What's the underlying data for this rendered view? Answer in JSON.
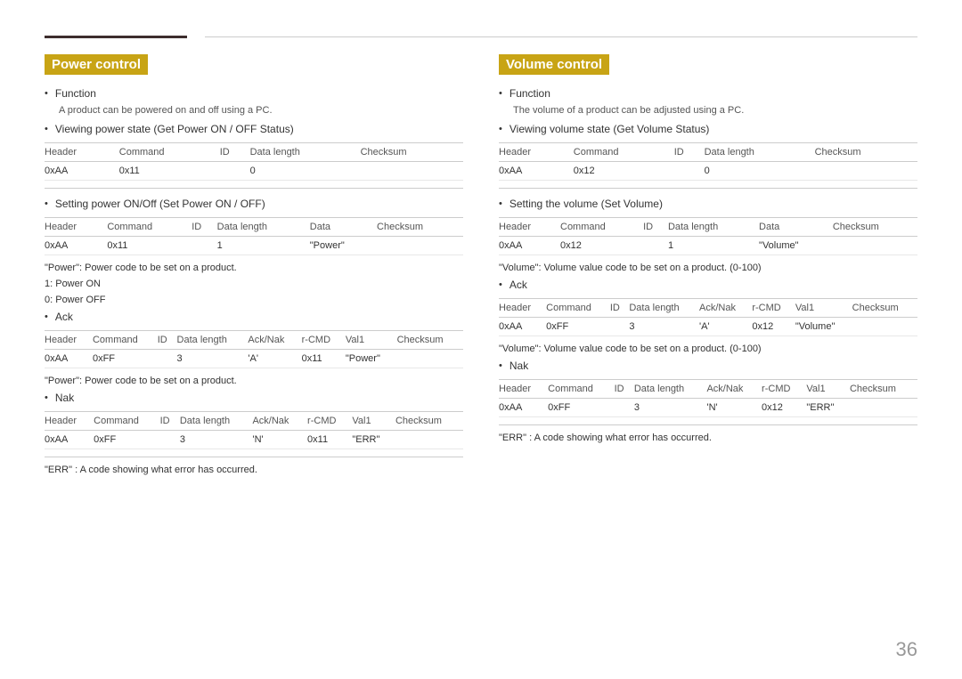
{
  "page_number": "36",
  "top_bar": {
    "bar_present": true
  },
  "left": {
    "title": "Power control",
    "function_label": "Function",
    "function_text": "A product can be powered on and off using a PC.",
    "viewing_label": "Viewing power state (Get Power ON / OFF Status)",
    "table1": {
      "headers": [
        "Header",
        "Command",
        "ID",
        "Data length",
        "Checksum"
      ],
      "rows": [
        [
          "0xAA",
          "0x11",
          "",
          "0",
          ""
        ]
      ]
    },
    "setting_label": "Setting power ON/Off (Set Power ON / OFF)",
    "table2": {
      "headers": [
        "Header",
        "Command",
        "ID",
        "Data length",
        "Data",
        "Checksum"
      ],
      "rows": [
        [
          "0xAA",
          "0x11",
          "",
          "1",
          "\"Power\"",
          ""
        ]
      ]
    },
    "note1": "\"Power\": Power code to be set on a product.",
    "power_on": "1: Power ON",
    "power_off": "0: Power OFF",
    "ack_label": "Ack",
    "table3": {
      "headers": [
        "Header",
        "Command",
        "ID",
        "Data length",
        "Ack/Nak",
        "r-CMD",
        "Val1",
        "Checksum"
      ],
      "rows": [
        [
          "0xAA",
          "0xFF",
          "",
          "3",
          "'A'",
          "0x11",
          "\"Power\"",
          ""
        ]
      ]
    },
    "note2": "\"Power\": Power code to be set on a product.",
    "nak_label": "Nak",
    "table4": {
      "headers": [
        "Header",
        "Command",
        "ID",
        "Data length",
        "Ack/Nak",
        "r-CMD",
        "Val1",
        "Checksum"
      ],
      "rows": [
        [
          "0xAA",
          "0xFF",
          "",
          "3",
          "'N'",
          "0x11",
          "\"ERR\"",
          ""
        ]
      ]
    },
    "err_note": "\"ERR\" : A code showing what error has occurred."
  },
  "right": {
    "title": "Volume control",
    "function_label": "Function",
    "function_text": "The volume of a product can be adjusted using a PC.",
    "viewing_label": "Viewing volume state (Get Volume Status)",
    "table1": {
      "headers": [
        "Header",
        "Command",
        "ID",
        "Data length",
        "Checksum"
      ],
      "rows": [
        [
          "0xAA",
          "0x12",
          "",
          "0",
          ""
        ]
      ]
    },
    "setting_label": "Setting the volume (Set Volume)",
    "table2": {
      "headers": [
        "Header",
        "Command",
        "ID",
        "Data length",
        "Data",
        "Checksum"
      ],
      "rows": [
        [
          "0xAA",
          "0x12",
          "",
          "1",
          "\"Volume\"",
          ""
        ]
      ]
    },
    "note1": "\"Volume\": Volume value code to be set on a product. (0-100)",
    "ack_label": "Ack",
    "table3": {
      "headers": [
        "Header",
        "Command",
        "ID",
        "Data length",
        "Ack/Nak",
        "r-CMD",
        "Val1",
        "Checksum"
      ],
      "rows": [
        [
          "0xAA",
          "0xFF",
          "",
          "3",
          "'A'",
          "0x12",
          "\"Volume\"",
          ""
        ]
      ]
    },
    "note2": "\"Volume\": Volume value code to be set on a product. (0-100)",
    "nak_label": "Nak",
    "table4": {
      "headers": [
        "Header",
        "Command",
        "ID",
        "Data length",
        "Ack/Nak",
        "r-CMD",
        "Val1",
        "Checksum"
      ],
      "rows": [
        [
          "0xAA",
          "0xFF",
          "",
          "3",
          "'N'",
          "0x12",
          "\"ERR\"",
          ""
        ]
      ]
    },
    "err_note": "\"ERR\" : A code showing what error has occurred."
  }
}
